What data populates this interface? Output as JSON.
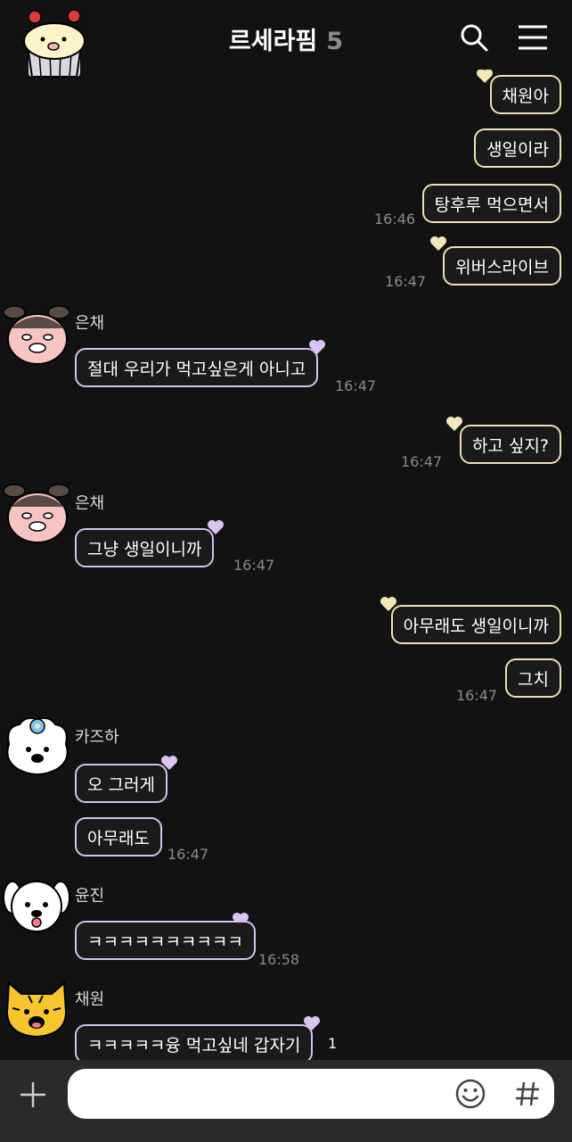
{
  "header": {
    "title": "르세라핌",
    "member_count": "5",
    "avatar_icon": "cupcake-avatar-icon",
    "search_icon": "search-icon",
    "menu_icon": "menu-icon"
  },
  "messages": {
    "m1": {
      "text": "채원아"
    },
    "m2": {
      "text": "생일이라"
    },
    "m3": {
      "text": "탕후루 먹으면서",
      "time": "16:46"
    },
    "m4": {
      "text": "위버스라이브",
      "time": "16:47"
    },
    "m5": {
      "sender": "은채",
      "text": "절대 우리가 먹고싶은게 아니고",
      "time": "16:47"
    },
    "m6": {
      "text": "하고 싶지?",
      "time": "16:47"
    },
    "m7": {
      "sender": "은채",
      "text": "그냥 생일이니까",
      "time": "16:47"
    },
    "m8": {
      "text": "아무래도 생일이니까"
    },
    "m9": {
      "text": "그치",
      "time": "16:47"
    },
    "m10": {
      "sender": "카즈하",
      "text": "오 그러게"
    },
    "m11": {
      "text": "아무래도",
      "time": "16:47"
    },
    "m12": {
      "sender": "윤진",
      "text": "ㅋㅋㅋㅋㅋㅋㅋㅋㅋㅋ",
      "time": "16:58"
    },
    "m13": {
      "sender": "채원",
      "text": "ㅋㅋㅋㅋㅋ융 먹고싶네 갑자기",
      "unread": "1"
    }
  },
  "input": {
    "placeholder": "",
    "plus_icon": "plus-icon",
    "emoji_icon": "emoji-icon",
    "hash_icon": "hashtag-icon"
  },
  "colors": {
    "background": "#121212",
    "outgoing_border": "#efe0b4",
    "incoming_border": "#d4c2ea",
    "heart_yellow": "#f3e6b8",
    "heart_purple": "#d9c3f0",
    "time_gray": "#8a8a8a"
  }
}
